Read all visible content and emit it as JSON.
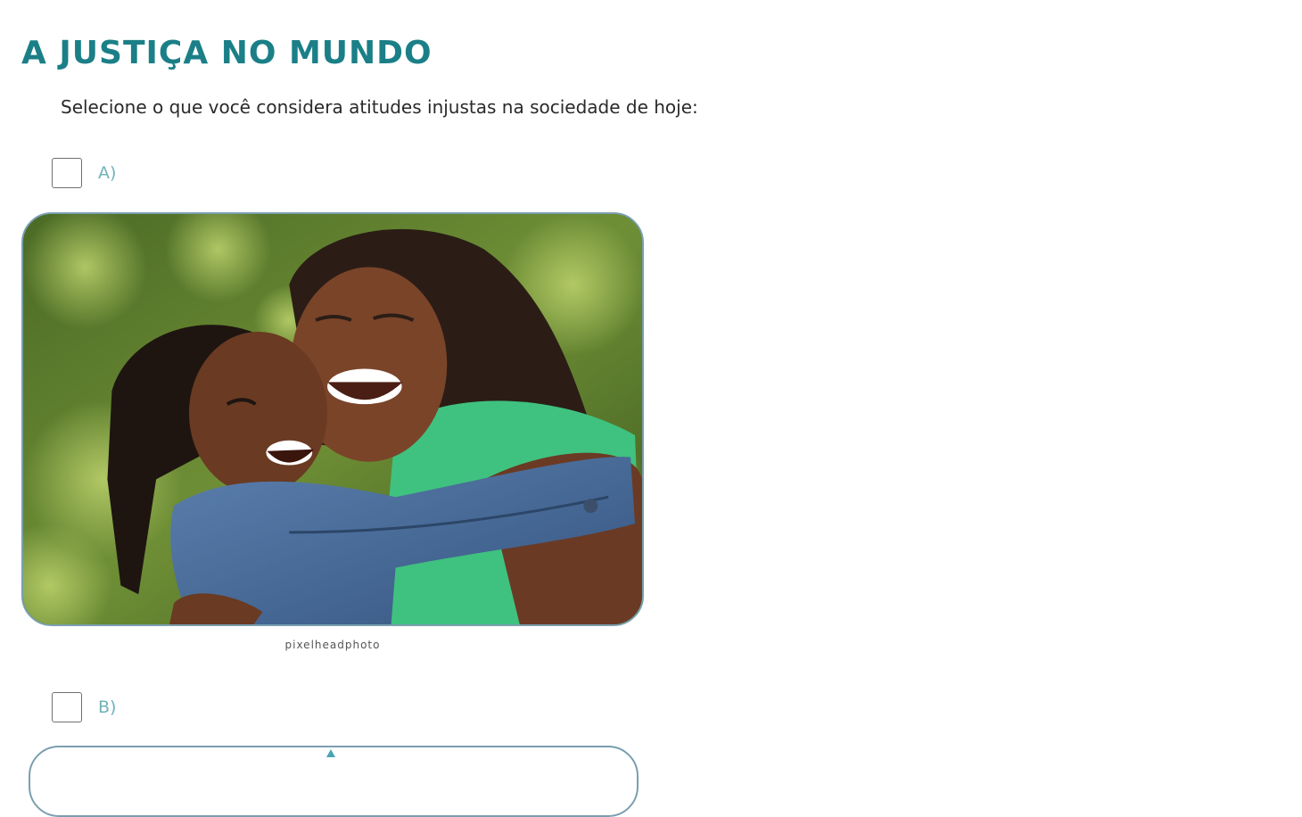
{
  "page": {
    "title": "A JUSTIÇA NO MUNDO",
    "instruction": "Selecione o que você considera atitudes injustas na sociedade de hoje:"
  },
  "options": [
    {
      "label": "A)",
      "checked": false,
      "image": {
        "description_icon": "photo-mother-daughter-hug",
        "credit": "pixelheadphoto"
      }
    },
    {
      "label": "B)",
      "checked": false
    }
  ],
  "colors": {
    "title": "#1b7f87",
    "option_label": "#6fb3b8",
    "frame_border": "#7a9fb0",
    "checkbox_border": "#707070"
  }
}
